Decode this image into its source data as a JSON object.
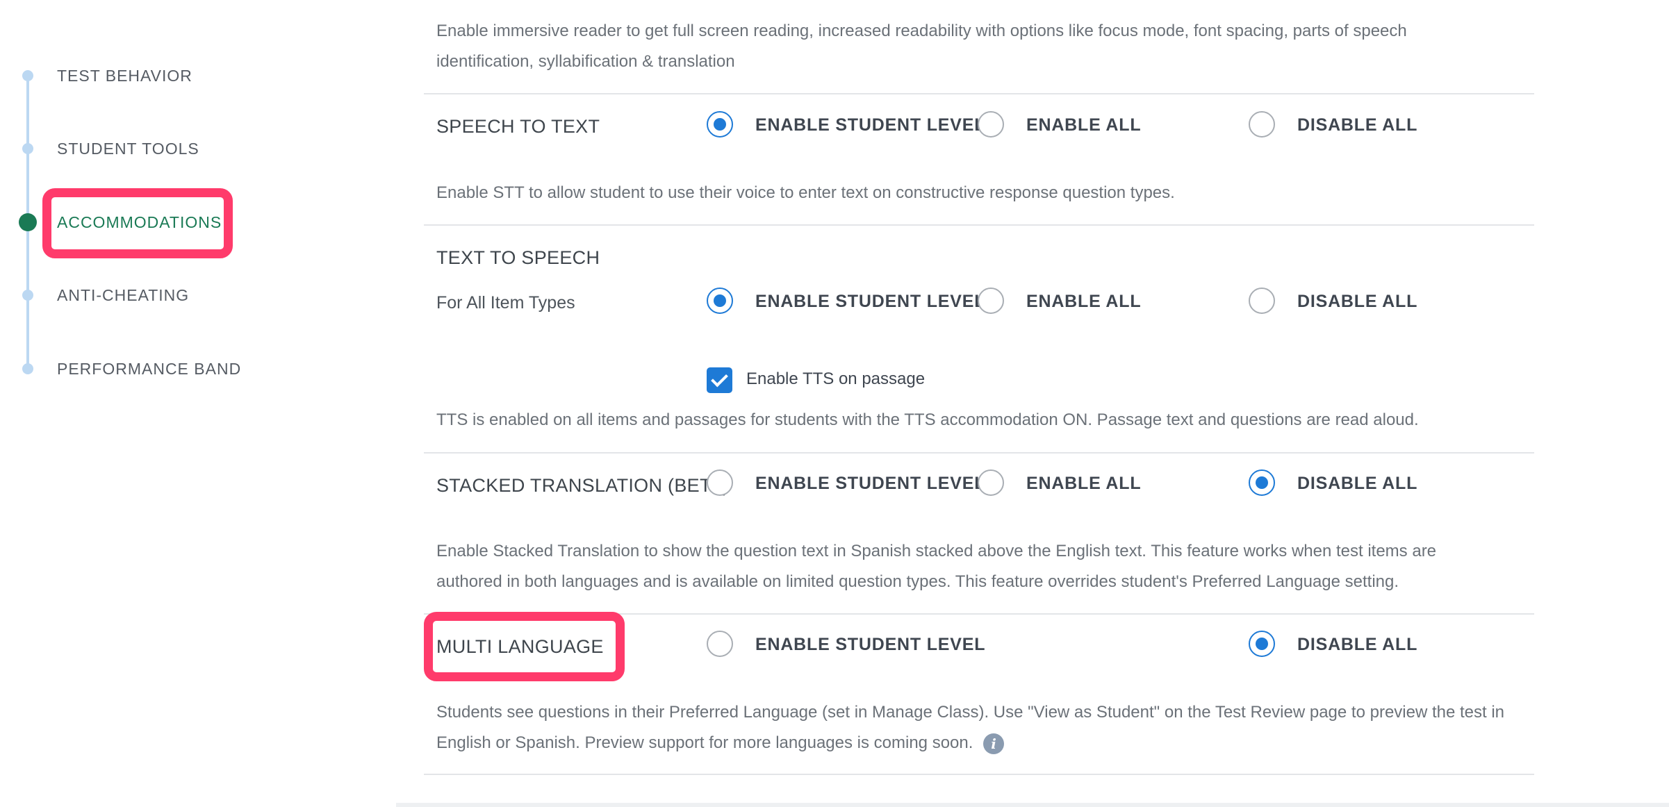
{
  "sidebar": {
    "items": [
      {
        "label": "TEST BEHAVIOR",
        "active": false
      },
      {
        "label": "STUDENT TOOLS",
        "active": false
      },
      {
        "label": "ACCOMMODATIONS",
        "active": true
      },
      {
        "label": "ANTI-CHEATING",
        "active": false
      },
      {
        "label": "PERFORMANCE BAND",
        "active": false
      }
    ]
  },
  "immersive_reader": {
    "description": "Enable immersive reader to get full screen reading, increased readability with options like focus mode, font spacing, parts of speech identification, syllabification & translation"
  },
  "speech_to_text": {
    "title": "SPEECH TO TEXT",
    "options": [
      "ENABLE STUDENT LEVEL",
      "ENABLE ALL",
      "DISABLE ALL"
    ],
    "selected": "ENABLE STUDENT LEVEL",
    "description": "Enable STT to allow student to use their voice to enter text on constructive response question types."
  },
  "text_to_speech": {
    "title": "TEXT TO SPEECH",
    "sub_label": "For All Item Types",
    "options": [
      "ENABLE STUDENT LEVEL",
      "ENABLE ALL",
      "DISABLE ALL"
    ],
    "selected": "ENABLE STUDENT LEVEL",
    "checkbox_label": "Enable TTS on passage",
    "checkbox_checked": true,
    "description": "TTS is enabled on all items and passages for students with the TTS accommodation ON. Passage text and questions are read aloud."
  },
  "stacked_translation": {
    "title": "STACKED TRANSLATION (BETA)",
    "options": [
      "ENABLE STUDENT LEVEL",
      "ENABLE ALL",
      "DISABLE ALL"
    ],
    "selected": "DISABLE ALL",
    "description": "Enable Stacked Translation to show the question text in Spanish stacked above the English text. This feature works when test items are authored in both languages and is available on limited question types. This feature overrides student's Preferred Language setting."
  },
  "multi_language": {
    "title": "MULTI LANGUAGE",
    "options": [
      "ENABLE STUDENT LEVEL",
      "DISABLE ALL"
    ],
    "selected": "DISABLE ALL",
    "description": "Students see questions in their Preferred Language (set in Manage Class). Use \"View as Student\" on the Test Review page to preview the test in English or Spanish. Preview support for more languages is coming soon."
  },
  "icons": {
    "info": "info-icon",
    "info_glyph": "i"
  },
  "colors": {
    "accent": "#1e7ad6",
    "active_nav": "#1a7a55",
    "highlight": "#ff3b6b"
  }
}
